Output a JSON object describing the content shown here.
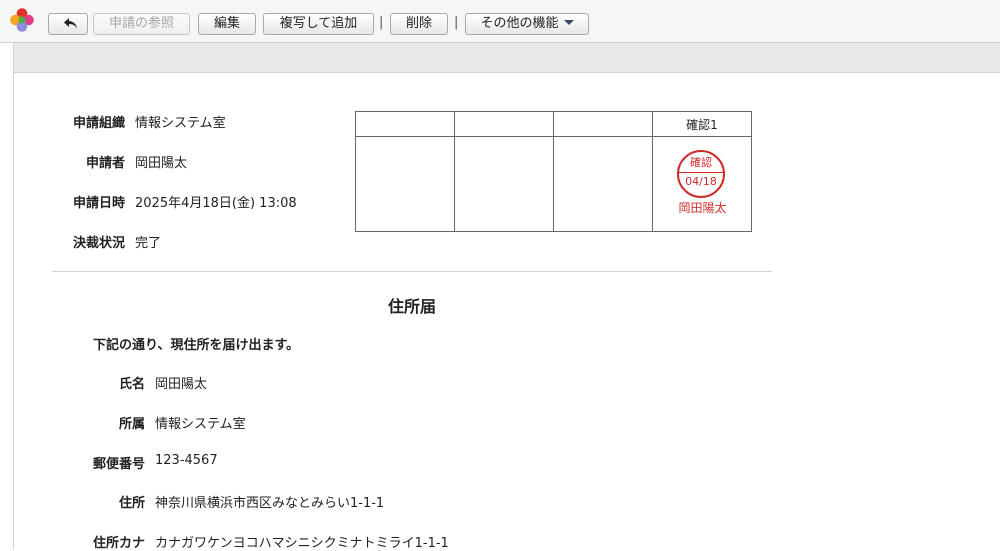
{
  "toolbar": {
    "back_label": "",
    "view_request_label": "申請の参照",
    "edit_label": "編集",
    "copy_add_label": "複写して追加",
    "separator": "|",
    "delete_label": "削除",
    "other_label": "その他の機能"
  },
  "request": {
    "org_label": "申請組織",
    "org_value": "情報システム室",
    "applicant_label": "申請者",
    "applicant_value": "岡田陽太",
    "datetime_label": "申請日時",
    "datetime_value": "2025年4月18日(金) 13:08",
    "status_label": "決裁状況",
    "status_value": "完了"
  },
  "approval": {
    "headers": [
      "",
      "",
      "",
      "確認1"
    ],
    "stamp": {
      "title": "確認",
      "date": "04/18",
      "name": "岡田陽太",
      "color": "#d12a2a"
    }
  },
  "form": {
    "title": "住所届",
    "lead": "下記の通り、現住所を届け出ます。",
    "fields": [
      {
        "label": "氏名",
        "value": "岡田陽太"
      },
      {
        "label": "所属",
        "value": "情報システム室"
      },
      {
        "label": "郵便番号",
        "value": "123-4567"
      },
      {
        "label": "住所",
        "value": "神奈川県横浜市西区みなとみらい1-1-1"
      },
      {
        "label": "住所カナ",
        "value": "カナガワケンヨコハマシニシクミナトミライ1-1-1"
      }
    ]
  }
}
